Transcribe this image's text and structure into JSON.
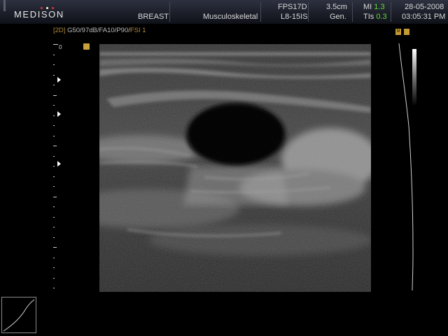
{
  "header": {
    "brand": "MEDISON",
    "exam_type": "BREAST",
    "application": "Musculoskeletal",
    "frame_rate": "FPS17D",
    "probe": "L8-15IS",
    "depth": "3.5cm",
    "frequency_mode": "Gen.",
    "mi_label": "MI",
    "mi_value": "1.3",
    "tis_label": "TIs",
    "tis_value": "0.3",
    "date": "28-05-2008",
    "time": "03:05:31 PM"
  },
  "mode_line": {
    "mode": "[2D]",
    "params": " G50/97dB/FA10/P90/",
    "fsi": "FSI 1"
  },
  "depth_scale": {
    "zero_label": "0"
  },
  "markers": {
    "top_right_label": "M"
  },
  "colors": {
    "accent_gold": "#c8a13c",
    "mode_text": "#b58d38",
    "index_value_green": "#5fdc34",
    "header_bg": "#1c1f29",
    "background": "#000000"
  },
  "icons": [
    "orientation-marker-icon",
    "focus-marker-icon",
    "gray-scale-bar",
    "tgc-curve",
    "post-processing-curve-icon"
  ]
}
